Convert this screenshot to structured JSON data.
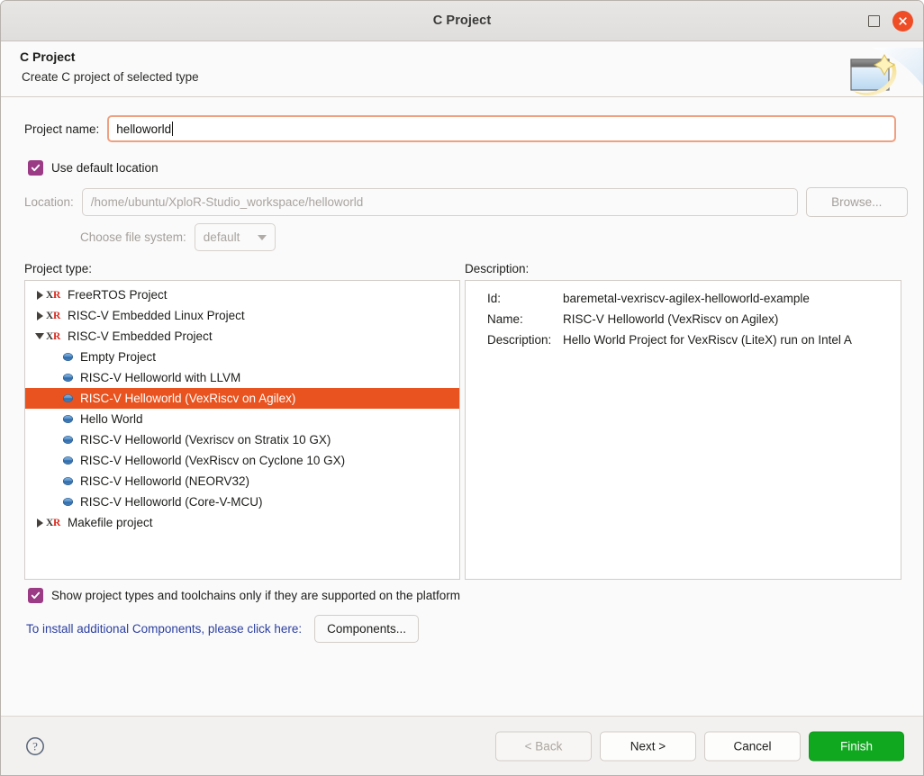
{
  "window": {
    "title": "C Project",
    "maximize_label": "maximize",
    "close_label": "close"
  },
  "header": {
    "title": "C Project",
    "subtitle": "Create C project of selected type",
    "icon": "new-project-wizard-icon"
  },
  "form": {
    "project_name_label": "Project name:",
    "project_name_value": "helloworld",
    "use_default_location_label": "Use default location",
    "use_default_location_checked": true,
    "location_label": "Location:",
    "location_value": "/home/ubuntu/XploR-Studio_workspace/helloworld",
    "browse_label": "Browse...",
    "file_system_label": "Choose file system:",
    "file_system_value": "default"
  },
  "project_type": {
    "label": "Project type:",
    "items": [
      {
        "label": "FreeRTOS Project",
        "level": 0,
        "icon": "xr-icon",
        "twisty": "right",
        "selected": false
      },
      {
        "label": "RISC-V Embedded Linux Project",
        "level": 0,
        "icon": "xr-icon",
        "twisty": "right",
        "selected": false
      },
      {
        "label": "RISC-V Embedded Project",
        "level": 0,
        "icon": "xr-icon",
        "twisty": "down",
        "selected": false
      },
      {
        "label": "Empty Project",
        "level": 1,
        "icon": "disc-icon",
        "twisty": "none",
        "selected": false
      },
      {
        "label": "RISC-V Helloworld with LLVM",
        "level": 1,
        "icon": "disc-icon",
        "twisty": "none",
        "selected": false
      },
      {
        "label": "RISC-V Helloworld (VexRiscv on Agilex)",
        "level": 1,
        "icon": "disc-icon",
        "twisty": "none",
        "selected": true
      },
      {
        "label": "Hello World",
        "level": 1,
        "icon": "disc-icon",
        "twisty": "none",
        "selected": false
      },
      {
        "label": "RISC-V Helloworld (Vexriscv on Stratix 10 GX)",
        "level": 1,
        "icon": "disc-icon",
        "twisty": "none",
        "selected": false
      },
      {
        "label": "RISC-V Helloworld (VexRiscv on Cyclone 10 GX)",
        "level": 1,
        "icon": "disc-icon",
        "twisty": "none",
        "selected": false
      },
      {
        "label": "RISC-V Helloworld (NEORV32)",
        "level": 1,
        "icon": "disc-icon",
        "twisty": "none",
        "selected": false
      },
      {
        "label": "RISC-V Helloworld (Core-V-MCU)",
        "level": 1,
        "icon": "disc-icon",
        "twisty": "none",
        "selected": false
      },
      {
        "label": "Makefile project",
        "level": 0,
        "icon": "xr-icon",
        "twisty": "right",
        "selected": false
      }
    ]
  },
  "description": {
    "label": "Description:",
    "rows": [
      {
        "key": "Id:",
        "value": "baremetal-vexriscv-agilex-helloworld-example"
      },
      {
        "key": "Name:",
        "value": "RISC-V Helloworld (VexRiscv on Agilex)"
      },
      {
        "key": "Description:",
        "value": "Hello World Project for VexRiscv (LiteX) run on Intel A"
      }
    ]
  },
  "options": {
    "show_supported_label": "Show project types and toolchains only if they are supported on the platform",
    "show_supported_checked": true,
    "install_components_text": "To install additional Components, please click here:",
    "components_button_label": "Components..."
  },
  "footer": {
    "help_label": "help-icon",
    "back_label": "< Back",
    "next_label": "Next >",
    "cancel_label": "Cancel",
    "finish_label": "Finish"
  },
  "colors": {
    "selection_orange": "#e8531f",
    "checkbox_purple": "#9b3a85",
    "finish_green": "#10a81f",
    "link_blue": "#2b3fa0",
    "close_red": "#ef4d26",
    "focus_border": "#f0a080"
  }
}
